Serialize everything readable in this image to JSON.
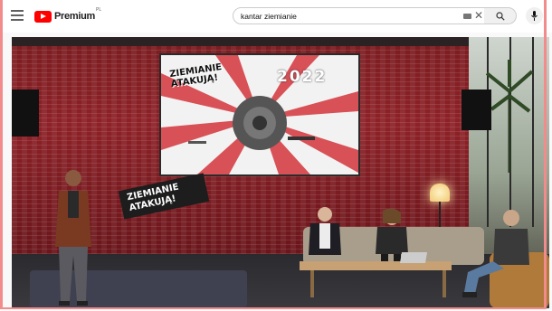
{
  "header": {
    "logo_text": "Premium",
    "logo_superscript": "PL",
    "search_value": "kantar ziemianie",
    "colors": {
      "brand": "#ff0000",
      "frame": "#f28b8b"
    },
    "icons": [
      "menu-icon",
      "youtube-logo-icon",
      "keyboard-icon",
      "clear-icon",
      "search-icon",
      "microphone-icon"
    ]
  },
  "video": {
    "screen_title_line1": "ZIEMIANIE",
    "screen_title_line2": "ATAKUJĄ!",
    "screen_year": "2022",
    "sign_line1": "ZIEMIANIE",
    "sign_line2": "ATAKUJĄ!"
  }
}
